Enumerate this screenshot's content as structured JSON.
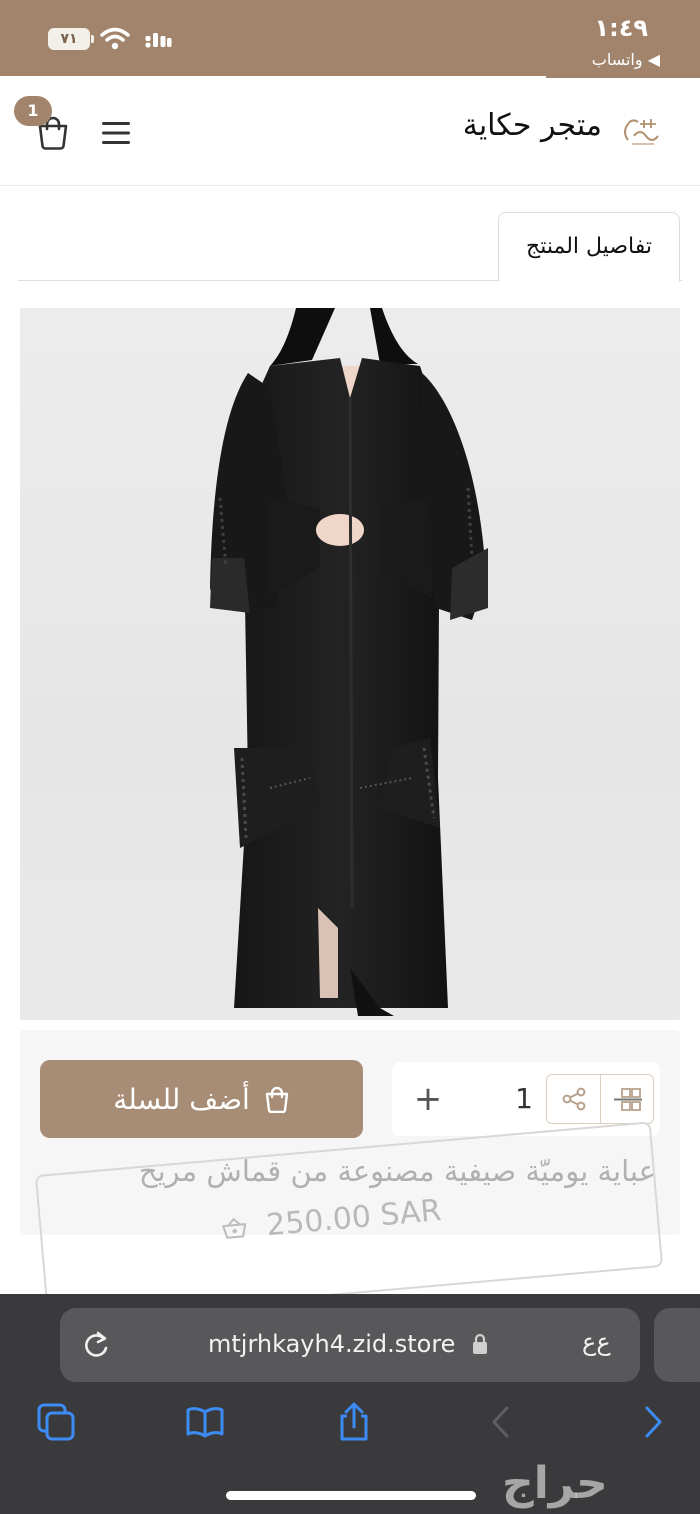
{
  "status_bar": {
    "time": "١:٤٩",
    "back_app": "◀ واتساب",
    "battery": "٧١"
  },
  "header": {
    "store_name": "متجر حكاية",
    "cart_count": "1"
  },
  "tabs": [
    {
      "label": "تفاصيل المنتج",
      "active": true
    }
  ],
  "product": {
    "add_to_cart_label": "أضف للسلة",
    "quantity": "1",
    "quantity_increment": "+",
    "title": "عباية يوميّة صيفية مصنوعة من قماش مريح",
    "price": "250.00 SAR"
  },
  "browser": {
    "url": "mtjrhkayh4.zid.store",
    "text_size_label": "ﻉﻉ"
  },
  "watermark": "حراج",
  "colors": {
    "brand": "#a1846b",
    "button": "#a88d76",
    "browser_bar": "#3a3a3c",
    "link_blue": "#3d8cf5"
  }
}
